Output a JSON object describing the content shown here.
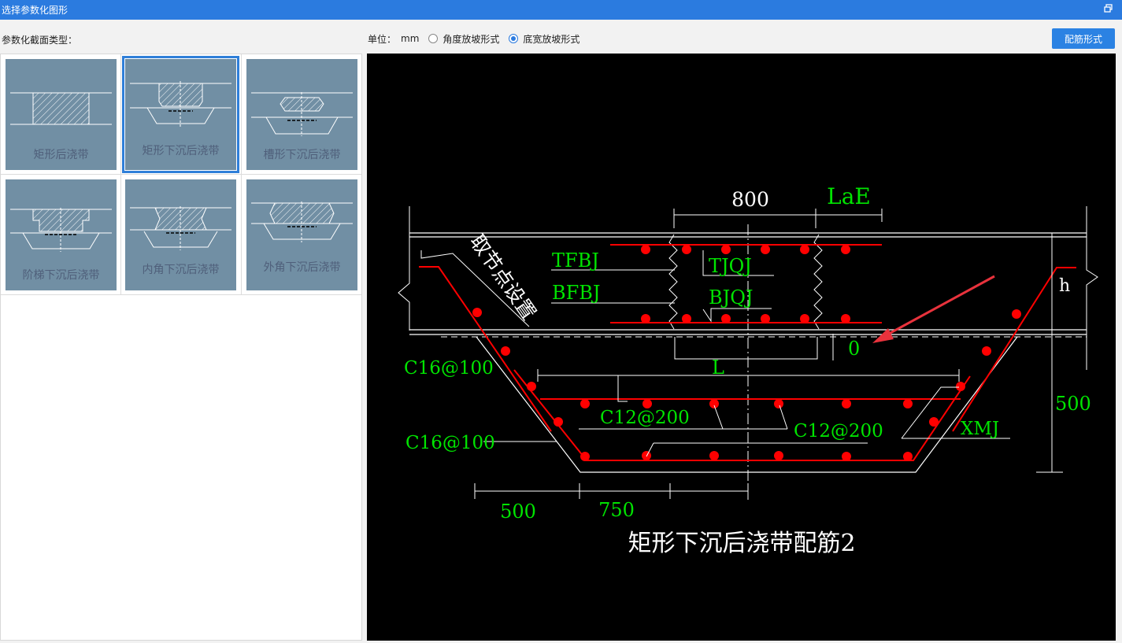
{
  "window": {
    "title": "选择参数化图形"
  },
  "section_label": "参数化截面类型：",
  "unit": {
    "label": "单位：",
    "value": "mm"
  },
  "slope_options": [
    {
      "label": "角度放坡形式",
      "selected": false
    },
    {
      "label": "底宽放坡形式",
      "selected": true
    }
  ],
  "rebar_button": "配筋形式",
  "thumbnails": [
    {
      "caption": "矩形后浇带",
      "selected": false
    },
    {
      "caption": "矩形下沉后浇带",
      "selected": true
    },
    {
      "caption": "槽形下沉后浇带",
      "selected": false
    },
    {
      "caption": "阶梯下沉后浇带",
      "selected": false
    },
    {
      "caption": "内角下沉后浇带",
      "selected": false
    },
    {
      "caption": "外角下沉后浇带",
      "selected": false
    }
  ],
  "drawing": {
    "title": "矩形下沉后浇带配筋2",
    "labels": {
      "width": "800",
      "lae": "LaE",
      "node_setting": "取节点设置",
      "tfbj": "TFBJ",
      "tjqj": "TJQJ",
      "bfbj": "BFBJ",
      "bjqj": "BJQJ",
      "h": "h",
      "zero": "0",
      "l": "L",
      "c16_top": "C16@100",
      "c12_left": "C12@200",
      "c12_right": "C12@200",
      "c16_bottom": "C16@100",
      "xmj": "XMJ",
      "depth": "500",
      "dim_left": "500",
      "dim_mid": "750"
    },
    "colors": {
      "rebar": "#ff0000",
      "label": "#00e400",
      "line": "#ffffff",
      "arrow": "#e8323c"
    }
  }
}
